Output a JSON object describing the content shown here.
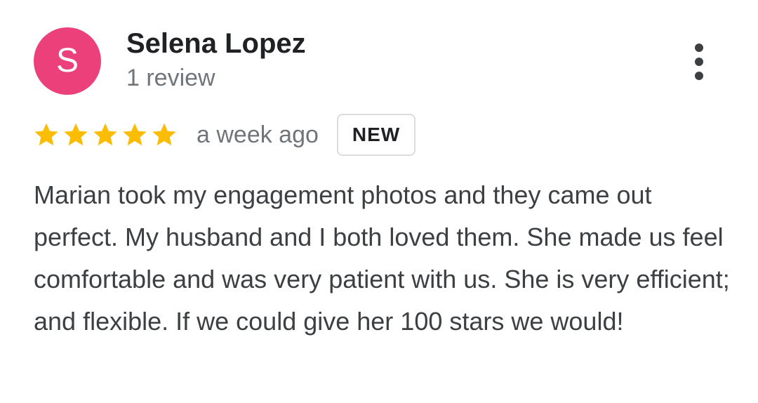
{
  "review": {
    "avatar_initial": "S",
    "avatar_color": "#ec407a",
    "reviewer_name": "Selena Lopez",
    "review_count": "1 review",
    "rating": 5,
    "rating_max": 5,
    "star_color": "#fbbc04",
    "date": "a week ago",
    "badge": "NEW",
    "text": "Marian took my engagement photos and they came out perfect. My husband and I both loved them. She made us feel comfortable and was very patient with us. She is very efficient; and flexible. If we could give her 100 stars we would!",
    "more_icon": "more-vert-icon"
  }
}
